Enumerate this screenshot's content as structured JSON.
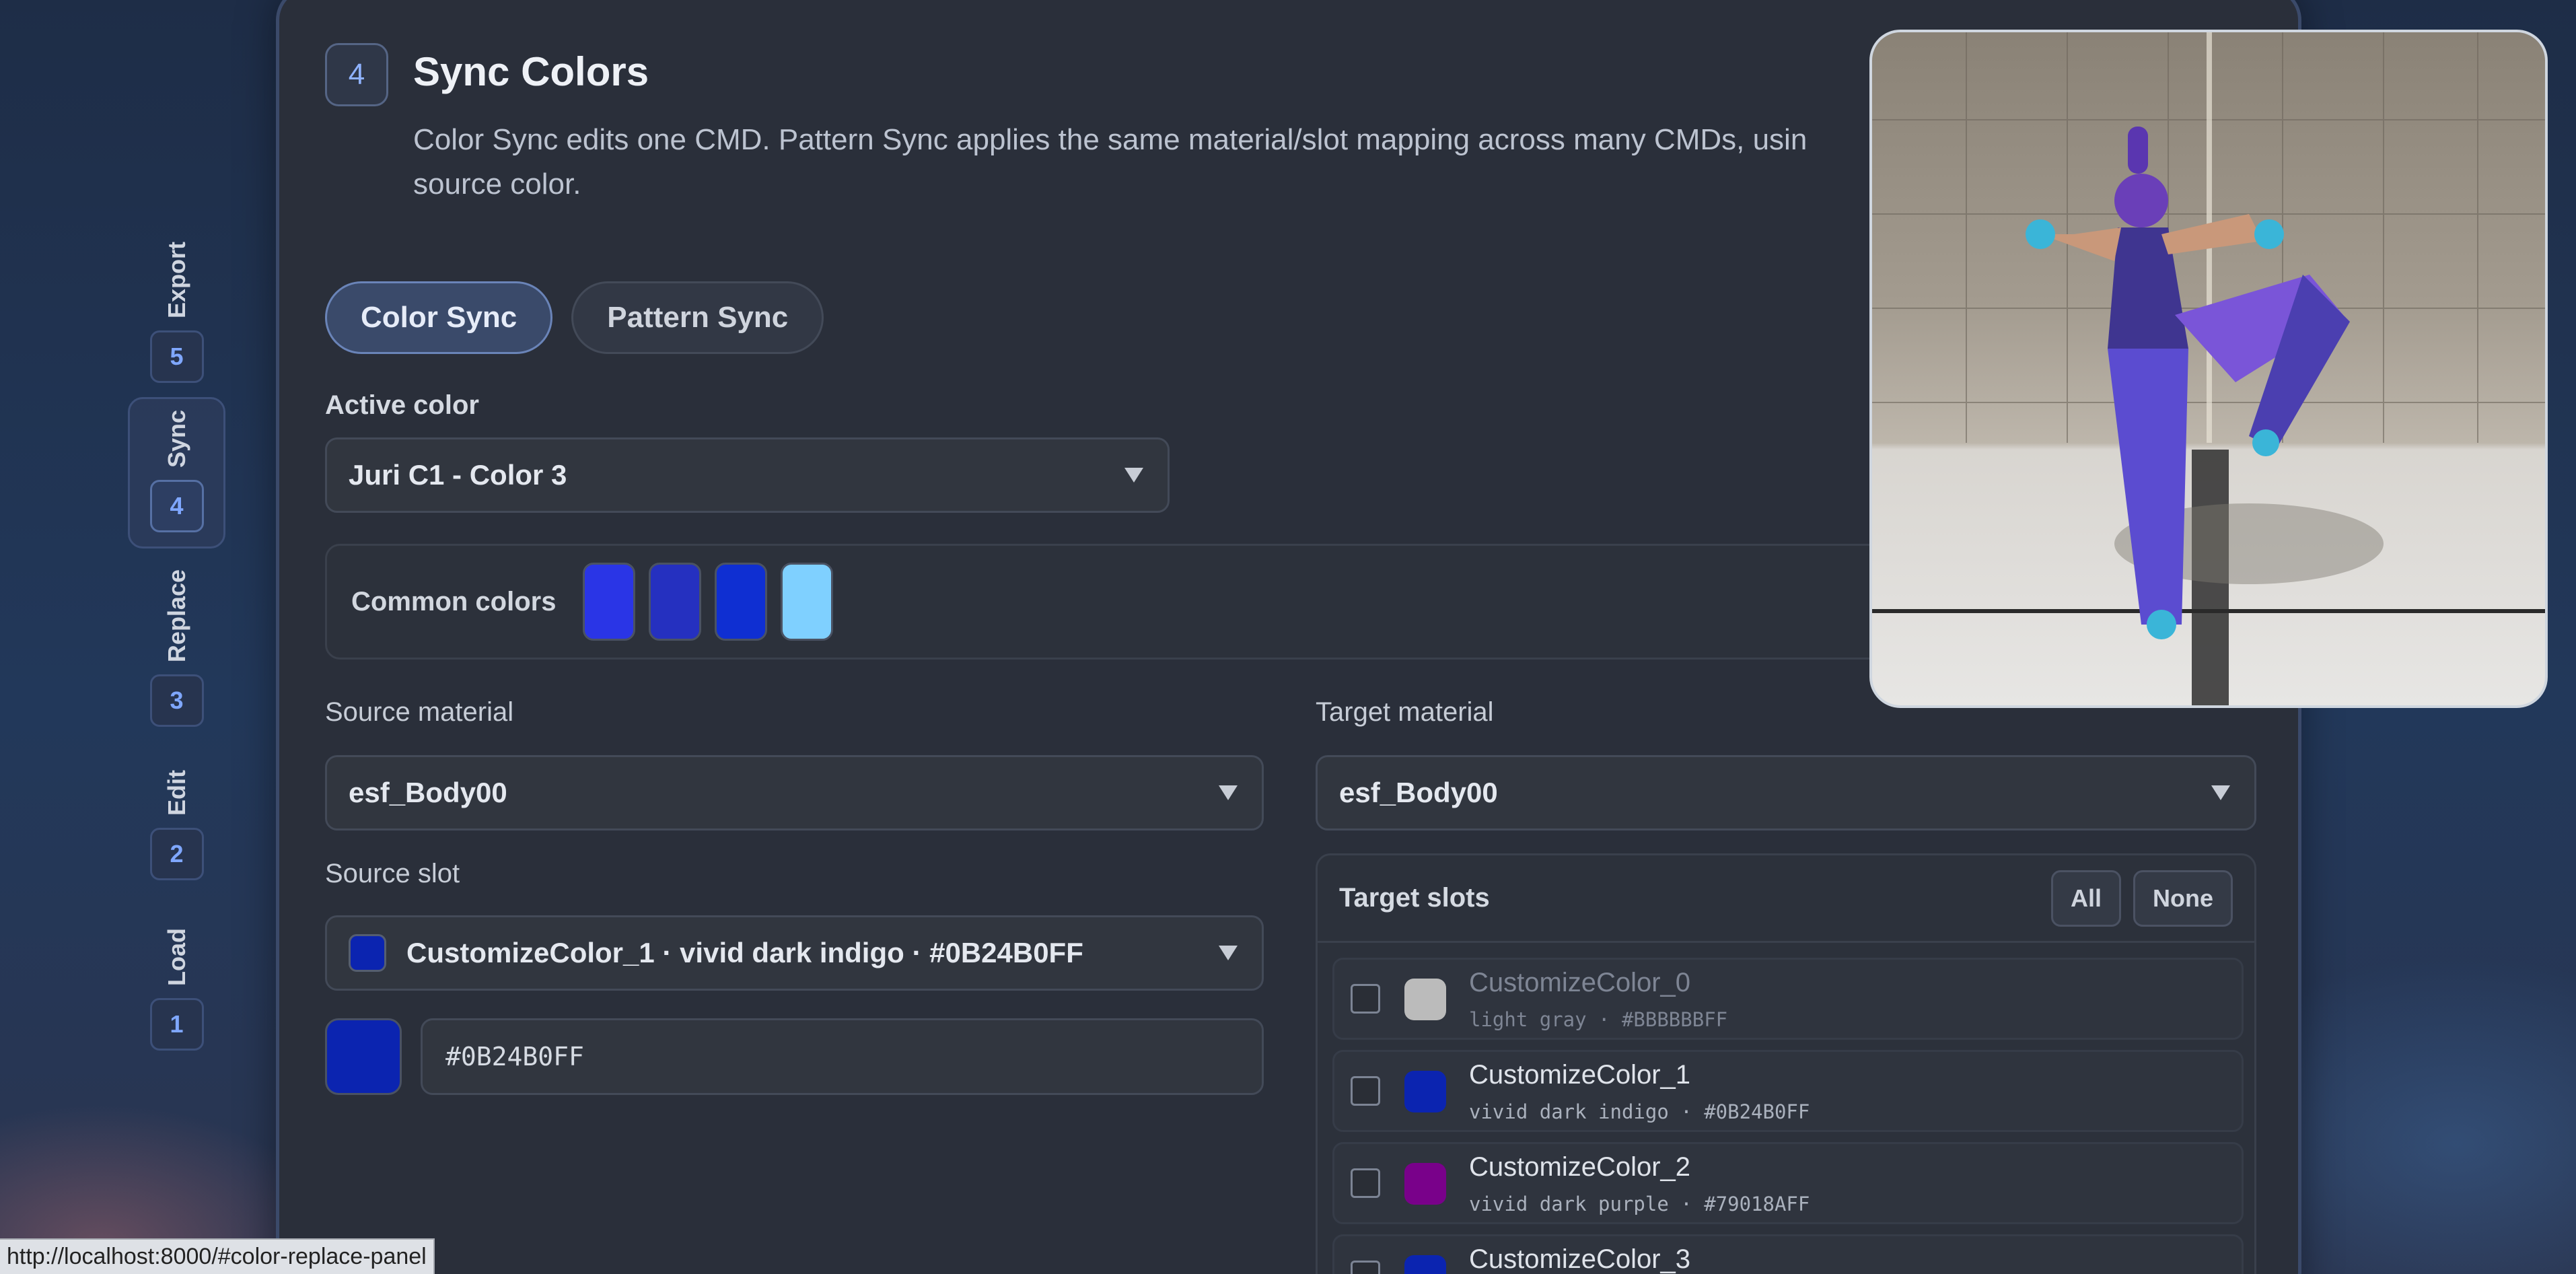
{
  "steps": [
    {
      "label": "Export",
      "num": "5"
    },
    {
      "label": "Sync",
      "num": "4"
    },
    {
      "label": "Replace",
      "num": "3"
    },
    {
      "label": "Edit",
      "num": "2"
    },
    {
      "label": "Load",
      "num": "1"
    }
  ],
  "active_step": "Sync",
  "section": {
    "number": "4",
    "title": "Sync Colors",
    "description": "Color Sync edits one CMD. Pattern Sync applies the same material/slot mapping across many CMDs, usin",
    "description_line2": "source color."
  },
  "tabs": [
    {
      "label": "Color Sync",
      "active": true
    },
    {
      "label": "Pattern Sync",
      "active": false
    }
  ],
  "active_color": {
    "label": "Active color",
    "value": "Juri C1 - Color 3"
  },
  "common_colors": {
    "label": "Common colors",
    "swatches": [
      "#2a35e6",
      "#2530c0",
      "#0f2fd2",
      "#7fd0ff"
    ]
  },
  "source_material": {
    "label": "Source material",
    "value": "esf_Body00"
  },
  "target_material": {
    "label": "Target material",
    "value": "esf_Body00"
  },
  "source_slot": {
    "label": "Source slot",
    "value": "CustomizeColor_1 · vivid dark indigo · #0B24B0FF",
    "swatch": "#0b24b0"
  },
  "hex": {
    "swatch": "#0b24b0",
    "value": "#0B24B0FF"
  },
  "target_slots": {
    "title": "Target slots",
    "all_label": "All",
    "none_label": "None",
    "items": [
      {
        "name": "CustomizeColor_0",
        "desc": "light gray · #BBBBBBFF",
        "color": "#bbbbbb",
        "dim": true
      },
      {
        "name": "CustomizeColor_1",
        "desc": "vivid dark indigo · #0B24B0FF",
        "color": "#0b24b0",
        "dim": false
      },
      {
        "name": "CustomizeColor_2",
        "desc": "vivid dark purple · #79018AFF",
        "color": "#79018a",
        "dim": false
      },
      {
        "name": "CustomizeColor_3",
        "desc": "",
        "color": "#0b24b0",
        "dim": false
      }
    ]
  },
  "status_url": "http://localhost:8000/#color-replace-panel"
}
